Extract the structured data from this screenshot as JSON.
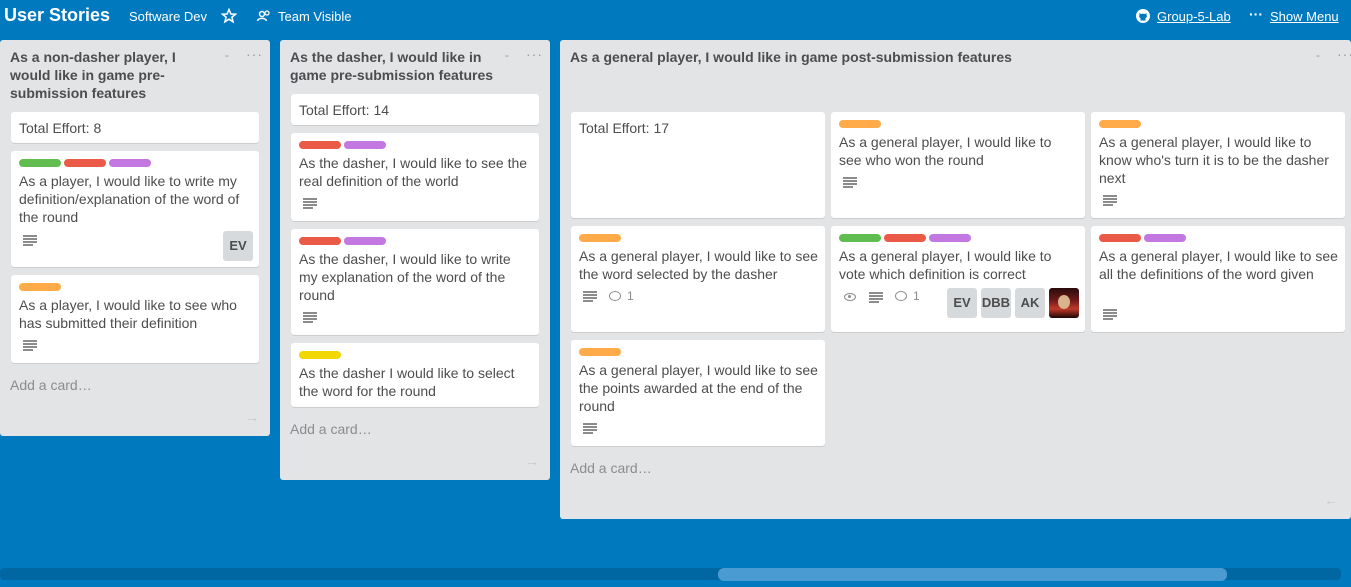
{
  "header": {
    "board_title": "User Stories",
    "org": "Software Dev",
    "star_icon": "star-icon",
    "visibility": "Team Visible",
    "github_link": "Group-5-Lab",
    "menu": "Show Menu"
  },
  "lists": [
    {
      "title": "As a non-dasher player, I would like in game pre-submission features",
      "add_card": "Add a card…",
      "cards": [
        {
          "text": "Total Effort: 8"
        },
        {
          "labels": [
            "green",
            "red",
            "purple"
          ],
          "text": "As a player, I would like to write my definition/explanation of the word of the round",
          "avatars": [
            "EV"
          ]
        },
        {
          "labels": [
            "orange"
          ],
          "text": "As a player, I would like to see who has submitted their definition"
        }
      ]
    },
    {
      "title": "As the dasher, I would like in game pre-submission features",
      "add_card": "Add a card…",
      "cards": [
        {
          "text": "Total Effort: 14"
        },
        {
          "labels": [
            "red",
            "purple"
          ],
          "text": "As the dasher, I would like to see the real definition of the world"
        },
        {
          "labels": [
            "red",
            "purple"
          ],
          "text": "As the dasher, I would like to write my explanation of the word of the round"
        },
        {
          "labels": [
            "yellow"
          ],
          "text": "As the dasher I would like to select the word for the round"
        }
      ]
    },
    {
      "title": "As a general player, I would like in game post-submission features",
      "add_card": "Add a card…",
      "cards": [
        {
          "text": "Total Effort: 17"
        },
        {
          "labels": [
            "orange"
          ],
          "text": "As a general player, I would like to see who won the round"
        },
        {
          "labels": [
            "orange"
          ],
          "text": "As a general player, I would like to know who's turn it is to be the dasher next"
        },
        {
          "labels": [
            "orange"
          ],
          "text": "As a general player, I would like to see the word selected by the dasher",
          "comments": "1"
        },
        {
          "labels": [
            "green",
            "red",
            "purple"
          ],
          "text": "As a general player, I would like to vote which definition is correct",
          "comments": "1",
          "avatars": [
            "EV",
            "DBB",
            "AK"
          ]
        },
        {
          "labels": [
            "red",
            "purple"
          ],
          "text": "As a general player, I would like to see all the definitions of the word given"
        },
        {
          "labels": [
            "orange"
          ],
          "text": "As a general player, I would like to see the points awarded at the end of the round"
        }
      ]
    }
  ],
  "colors": {
    "board_bg": "#0079bf",
    "list_bg": "#e2e4e6",
    "green": "#61bd4f",
    "red": "#eb5a46",
    "purple": "#c377e0",
    "orange": "#ffab4a",
    "yellow": "#f2d600"
  }
}
